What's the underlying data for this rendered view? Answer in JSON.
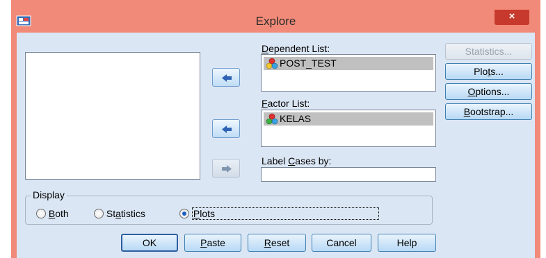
{
  "window": {
    "title": "Explore",
    "close_symbol": "×"
  },
  "colors": {
    "titlebar": "#f18a78",
    "client": "#dbe6f4",
    "close": "#c7392c",
    "selection": "#c0c0c0"
  },
  "variables_list": {
    "items": []
  },
  "dependent_list": {
    "label_pre": "",
    "label_key": "D",
    "label_post": "ependent List:",
    "items": [
      {
        "name": "POST_TEST",
        "icon": "scale-variable-icon"
      }
    ]
  },
  "factor_list": {
    "label_pre": "",
    "label_key": "F",
    "label_post": "actor List:",
    "items": [
      {
        "name": "KELAS",
        "icon": "nominal-variable-icon"
      }
    ]
  },
  "label_cases": {
    "label_pre": "Label ",
    "label_key": "C",
    "label_post": "ases by:",
    "value": ""
  },
  "side_buttons": {
    "statistics": "Statistics...",
    "plots_pre": "Plo",
    "plots_key": "t",
    "plots_post": "s...",
    "options_key": "O",
    "options_post": "ptions...",
    "bootstrap_key": "B",
    "bootstrap_post": "ootstrap..."
  },
  "display": {
    "legend": "Display",
    "both_key": "B",
    "both_post": "oth",
    "stats_pre": "St",
    "stats_key": "a",
    "stats_post": "tistics",
    "plots_pre": "",
    "plots_key": "P",
    "plots_post": "lots",
    "selected": "Plots"
  },
  "footer": {
    "ok": "OK",
    "paste_key": "P",
    "paste_post": "aste",
    "reset_key": "R",
    "reset_post": "eset",
    "cancel": "Cancel",
    "help": "Help"
  }
}
